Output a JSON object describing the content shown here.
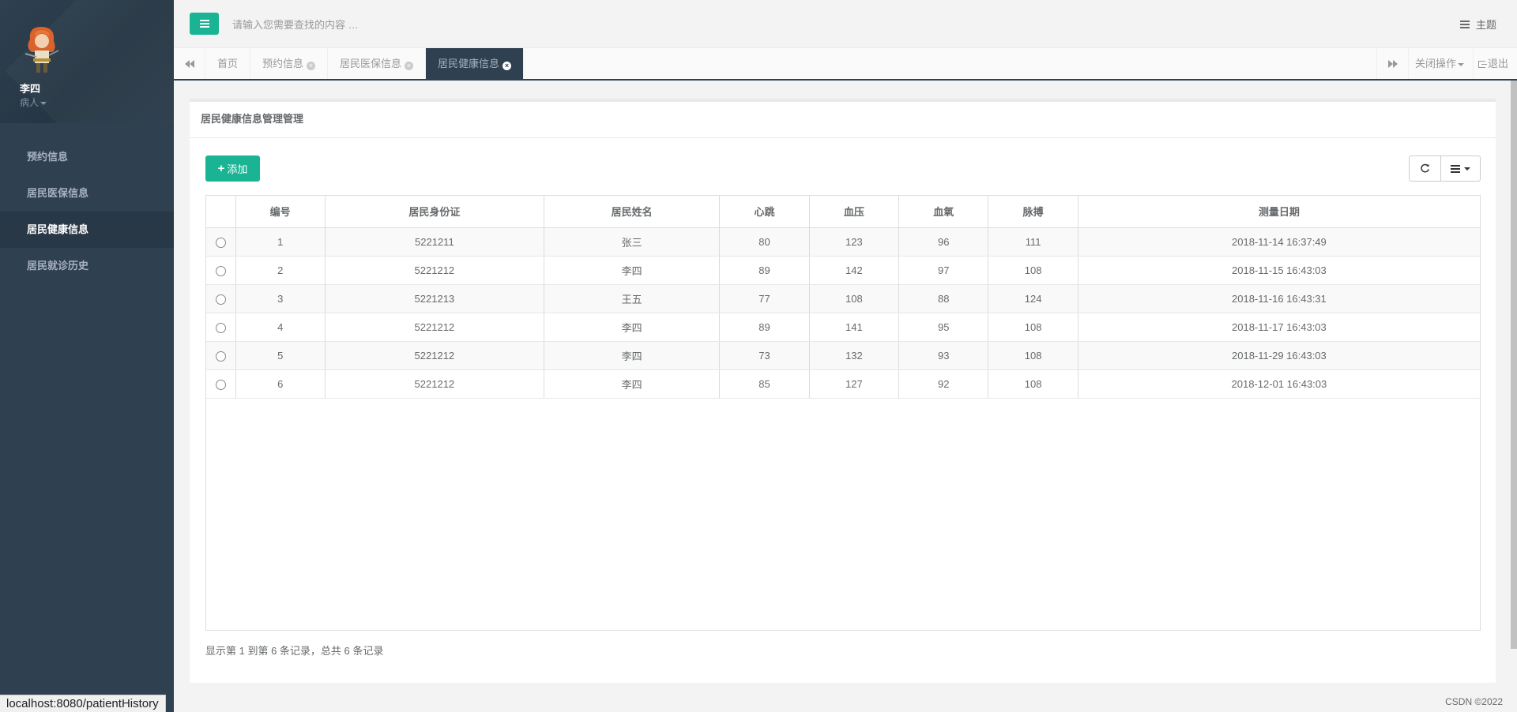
{
  "user": {
    "name": "李四",
    "role": "病人"
  },
  "nav": [
    {
      "label": "预约信息",
      "active": false
    },
    {
      "label": "居民医保信息",
      "active": false
    },
    {
      "label": "居民健康信息",
      "active": true
    },
    {
      "label": "居民就诊历史",
      "active": false
    }
  ],
  "search": {
    "placeholder": "请输入您需要查找的内容 …"
  },
  "theme_label": "主题",
  "tabs": [
    {
      "label": "首页",
      "closable": false,
      "active": false
    },
    {
      "label": "预约信息",
      "closable": true,
      "active": false
    },
    {
      "label": "居民医保信息",
      "closable": true,
      "active": false
    },
    {
      "label": "居民健康信息",
      "closable": true,
      "active": true
    }
  ],
  "close_ops_label": "关闭操作",
  "logout_label": "退出",
  "panel_title": "居民健康信息管理管理",
  "add_button_label": "添加",
  "table": {
    "columns": [
      "编号",
      "居民身份证",
      "居民姓名",
      "心跳",
      "血压",
      "血氧",
      "脉搏",
      "测量日期"
    ],
    "rows": [
      [
        "1",
        "5221211",
        "张三",
        "80",
        "123",
        "96",
        "111",
        "2018-11-14 16:37:49"
      ],
      [
        "2",
        "5221212",
        "李四",
        "89",
        "142",
        "97",
        "108",
        "2018-11-15 16:43:03"
      ],
      [
        "3",
        "5221213",
        "王五",
        "77",
        "108",
        "88",
        "124",
        "2018-11-16 16:43:31"
      ],
      [
        "4",
        "5221212",
        "李四",
        "89",
        "141",
        "95",
        "108",
        "2018-11-17 16:43:03"
      ],
      [
        "5",
        "5221212",
        "李四",
        "73",
        "132",
        "93",
        "108",
        "2018-11-29 16:43:03"
      ],
      [
        "6",
        "5221212",
        "李四",
        "85",
        "127",
        "92",
        "108",
        "2018-12-01 16:43:03"
      ]
    ]
  },
  "page_info": "显示第 1 到第 6 条记录，总共 6 条记录",
  "status_url": "localhost:8080/patientHistory",
  "footer": "CSDN ©2022",
  "colors": {
    "accent": "#1ab394",
    "sidebar": "#2f4050",
    "sidebar_active": "#293846"
  }
}
